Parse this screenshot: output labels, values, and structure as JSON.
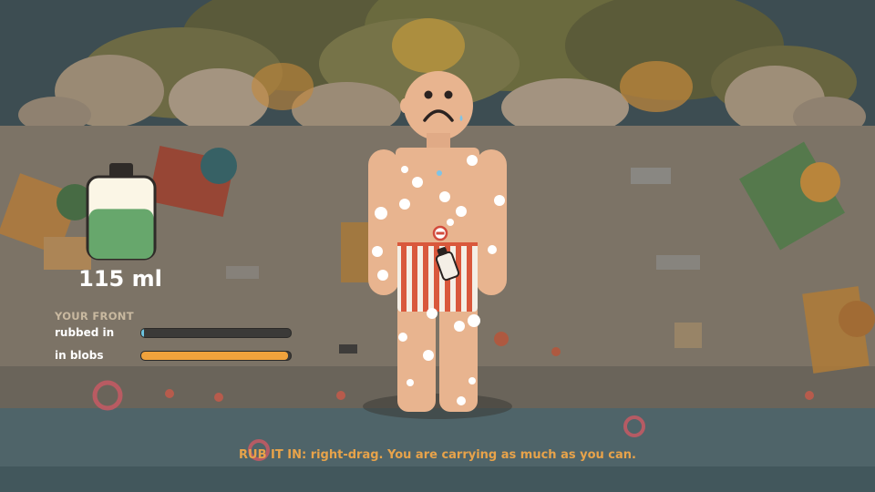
{
  "hud": {
    "bottle": {
      "fill_fraction": 0.62,
      "liquid_color": "#67a76c",
      "cap_color": "#2f2b28"
    },
    "volume_label": "115 ml",
    "section_title": "YOUR FRONT",
    "stats": [
      {
        "label": "rubbed in",
        "fraction": 0.02,
        "color": "#6cc4e0"
      },
      {
        "label": "in blobs",
        "fraction": 0.98,
        "color": "#f0a23c"
      }
    ]
  },
  "instruction_text": "RUB IT IN: right-drag. You are carrying as much as you can.",
  "colors": {
    "skin": "#e8b48f",
    "trunks_red": "#d9583c",
    "beach_sand": "#7c7366",
    "sea": "#4f6469",
    "sunscreen_blob": "#ffffff"
  },
  "icons": [
    "sunscreen-bottle-icon",
    "no-entry-icon",
    "cursor-bottle-icon",
    "sad-face-icon"
  ]
}
